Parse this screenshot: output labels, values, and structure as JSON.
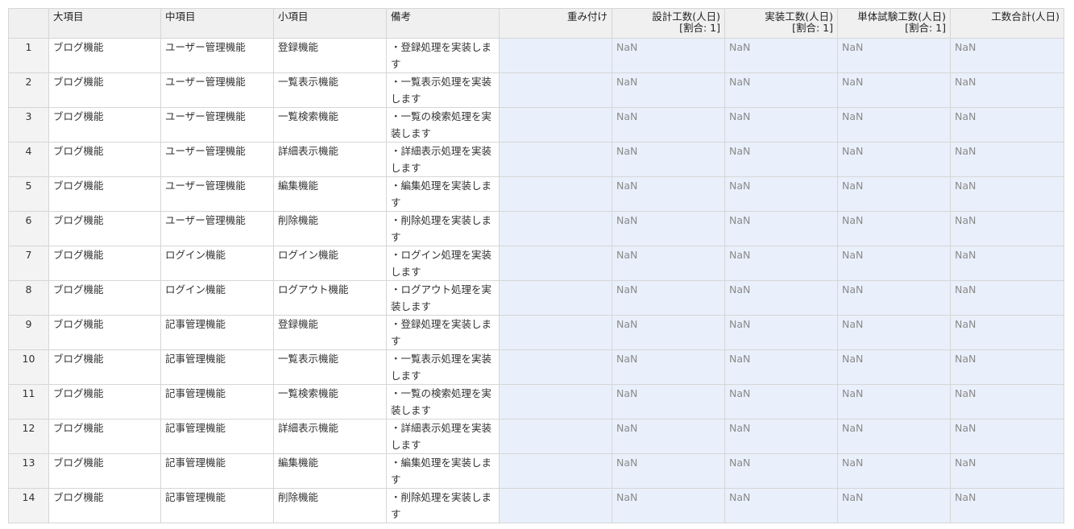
{
  "columns": {
    "rownum": "",
    "dai": "大項目",
    "chu": "中項目",
    "sho": "小項目",
    "biko": "備考",
    "weight": "重み付け",
    "design": "設計工数(人日)",
    "design_ratio": "[割合: 1]",
    "impl": "実装工数(人日)",
    "impl_ratio": "[割合: 1]",
    "unit": "単体試験工数(人日)",
    "unit_ratio": "[割合: 1]",
    "total": "工数合計(人日)"
  },
  "rows": [
    {
      "no": "1",
      "dai": "ブログ機能",
      "chu": "ユーザー管理機能",
      "sho": "登録機能",
      "biko": "・登録処理を実装します",
      "weight": "",
      "design": "NaN",
      "impl": "NaN",
      "unit": "NaN",
      "total": "NaN"
    },
    {
      "no": "2",
      "dai": "ブログ機能",
      "chu": "ユーザー管理機能",
      "sho": "一覧表示機能",
      "biko": "・一覧表示処理を実装します",
      "weight": "",
      "design": "NaN",
      "impl": "NaN",
      "unit": "NaN",
      "total": "NaN"
    },
    {
      "no": "3",
      "dai": "ブログ機能",
      "chu": "ユーザー管理機能",
      "sho": "一覧検索機能",
      "biko": "・一覧の検索処理を実装します",
      "weight": "",
      "design": "NaN",
      "impl": "NaN",
      "unit": "NaN",
      "total": "NaN"
    },
    {
      "no": "4",
      "dai": "ブログ機能",
      "chu": "ユーザー管理機能",
      "sho": "詳細表示機能",
      "biko": "・詳細表示処理を実装します",
      "weight": "",
      "design": "NaN",
      "impl": "NaN",
      "unit": "NaN",
      "total": "NaN"
    },
    {
      "no": "5",
      "dai": "ブログ機能",
      "chu": "ユーザー管理機能",
      "sho": "編集機能",
      "biko": "・編集処理を実装します",
      "weight": "",
      "design": "NaN",
      "impl": "NaN",
      "unit": "NaN",
      "total": "NaN"
    },
    {
      "no": "6",
      "dai": "ブログ機能",
      "chu": "ユーザー管理機能",
      "sho": "削除機能",
      "biko": "・削除処理を実装します",
      "weight": "",
      "design": "NaN",
      "impl": "NaN",
      "unit": "NaN",
      "total": "NaN"
    },
    {
      "no": "7",
      "dai": "ブログ機能",
      "chu": "ログイン機能",
      "sho": "ログイン機能",
      "biko": "・ログイン処理を実装します",
      "weight": "",
      "design": "NaN",
      "impl": "NaN",
      "unit": "NaN",
      "total": "NaN"
    },
    {
      "no": "8",
      "dai": "ブログ機能",
      "chu": "ログイン機能",
      "sho": "ログアウト機能",
      "biko": "・ログアウト処理を実装します",
      "weight": "",
      "design": "NaN",
      "impl": "NaN",
      "unit": "NaN",
      "total": "NaN"
    },
    {
      "no": "9",
      "dai": "ブログ機能",
      "chu": "記事管理機能",
      "sho": "登録機能",
      "biko": "・登録処理を実装します",
      "weight": "",
      "design": "NaN",
      "impl": "NaN",
      "unit": "NaN",
      "total": "NaN"
    },
    {
      "no": "10",
      "dai": "ブログ機能",
      "chu": "記事管理機能",
      "sho": "一覧表示機能",
      "biko": "・一覧表示処理を実装します",
      "weight": "",
      "design": "NaN",
      "impl": "NaN",
      "unit": "NaN",
      "total": "NaN"
    },
    {
      "no": "11",
      "dai": "ブログ機能",
      "chu": "記事管理機能",
      "sho": "一覧検索機能",
      "biko": "・一覧の検索処理を実装します",
      "weight": "",
      "design": "NaN",
      "impl": "NaN",
      "unit": "NaN",
      "total": "NaN"
    },
    {
      "no": "12",
      "dai": "ブログ機能",
      "chu": "記事管理機能",
      "sho": "詳細表示機能",
      "biko": "・詳細表示処理を実装します",
      "weight": "",
      "design": "NaN",
      "impl": "NaN",
      "unit": "NaN",
      "total": "NaN"
    },
    {
      "no": "13",
      "dai": "ブログ機能",
      "chu": "記事管理機能",
      "sho": "編集機能",
      "biko": "・編集処理を実装します",
      "weight": "",
      "design": "NaN",
      "impl": "NaN",
      "unit": "NaN",
      "total": "NaN"
    },
    {
      "no": "14",
      "dai": "ブログ機能",
      "chu": "記事管理機能",
      "sho": "削除機能",
      "biko": "・削除処理を実装します",
      "weight": "",
      "design": "NaN",
      "impl": "NaN",
      "unit": "NaN",
      "total": "NaN"
    }
  ],
  "colors": {
    "header_bg": "#f0f0f0",
    "editable_bg": "#e9f0fb",
    "border": "#d6d6d6",
    "nan_text": "#8a8a8a"
  }
}
